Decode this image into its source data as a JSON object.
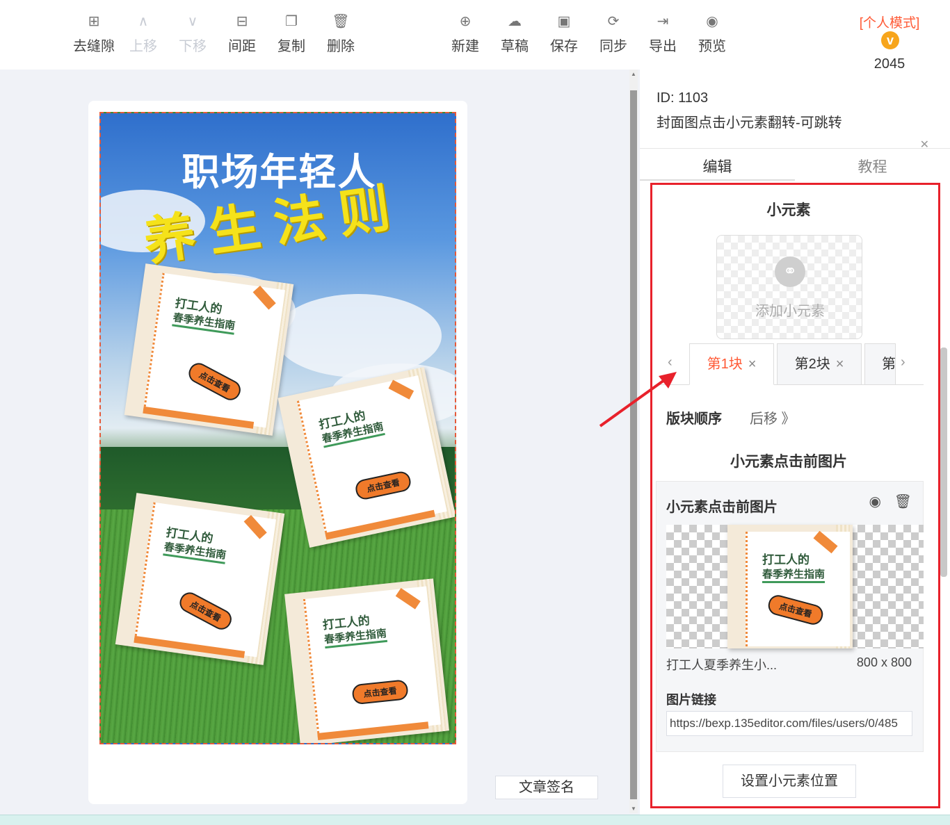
{
  "toolbar": {
    "left_buttons": [
      {
        "label": "去缝隙",
        "icon": "grid-icon",
        "glyph": "⊞",
        "disabled": false
      },
      {
        "label": "上移",
        "icon": "chevron-up-icon",
        "glyph": "∧",
        "disabled": true
      },
      {
        "label": "下移",
        "icon": "chevron-down-icon",
        "glyph": "∨",
        "disabled": true
      },
      {
        "label": "间距",
        "icon": "spacing-icon",
        "glyph": "⊟",
        "disabled": false
      },
      {
        "label": "复制",
        "icon": "copy-icon",
        "glyph": "❐",
        "disabled": false
      },
      {
        "label": "删除",
        "icon": "trash-icon",
        "glyph": "🗑",
        "disabled": false
      }
    ],
    "right_buttons": [
      {
        "label": "新建",
        "icon": "new-file-icon",
        "glyph": "⊕",
        "disabled": false
      },
      {
        "label": "草稿",
        "icon": "cloud-icon",
        "glyph": "☁",
        "disabled": false
      },
      {
        "label": "保存",
        "icon": "save-icon",
        "glyph": "▣",
        "disabled": false
      },
      {
        "label": "同步",
        "icon": "sync-icon",
        "glyph": "⟳",
        "disabled": false
      },
      {
        "label": "导出",
        "icon": "export-icon",
        "glyph": "⇥",
        "disabled": false
      },
      {
        "label": "预览",
        "icon": "eye-icon",
        "glyph": "◉",
        "disabled": false
      }
    ],
    "mode_label": "[个人模式]",
    "mode_badge": "v",
    "mode_number": "2045"
  },
  "poster": {
    "title_line1": "职场年轻人",
    "title_line2": "养生法则",
    "notes": [
      {
        "heading1": "打工人的",
        "heading2": "春季养生指南",
        "cta": "点击查看"
      },
      {
        "heading1": "打工人的",
        "heading2": "春季养生指南",
        "cta": "点击查看"
      },
      {
        "heading1": "打工人的",
        "heading2": "春季养生指南",
        "cta": "点击查看"
      },
      {
        "heading1": "打工人的",
        "heading2": "春季养生指南",
        "cta": "点击查看"
      }
    ]
  },
  "sign_button": "文章签名",
  "panel": {
    "id_text": "ID: 1103",
    "name": "封面图点击小元素翻转-可跳转",
    "tabs": [
      "编辑",
      "教程"
    ],
    "section_title": "小元素",
    "add_label": "添加小元素",
    "block_tabs": [
      {
        "label": "第1块",
        "close": "×"
      },
      {
        "label": "第2块",
        "close": "×"
      },
      {
        "label": "第",
        "close": ""
      }
    ],
    "nav_prev": "‹",
    "nav_next": "›",
    "order_label": "版块顺序",
    "order_action": "后移 》",
    "before_image_title": "小元素点击前图片",
    "card": {
      "header": "小元素点击前图片",
      "preview_heading1": "打工人的",
      "preview_heading2": "春季养生指南",
      "preview_cta": "点击查看",
      "file_name": "打工人夏季养生小...",
      "file_size": "800 x 800",
      "link_label": "图片链接",
      "link_value": "https://bexp.135editor.com/files/users/0/485"
    },
    "position_button": "设置小元素位置"
  }
}
